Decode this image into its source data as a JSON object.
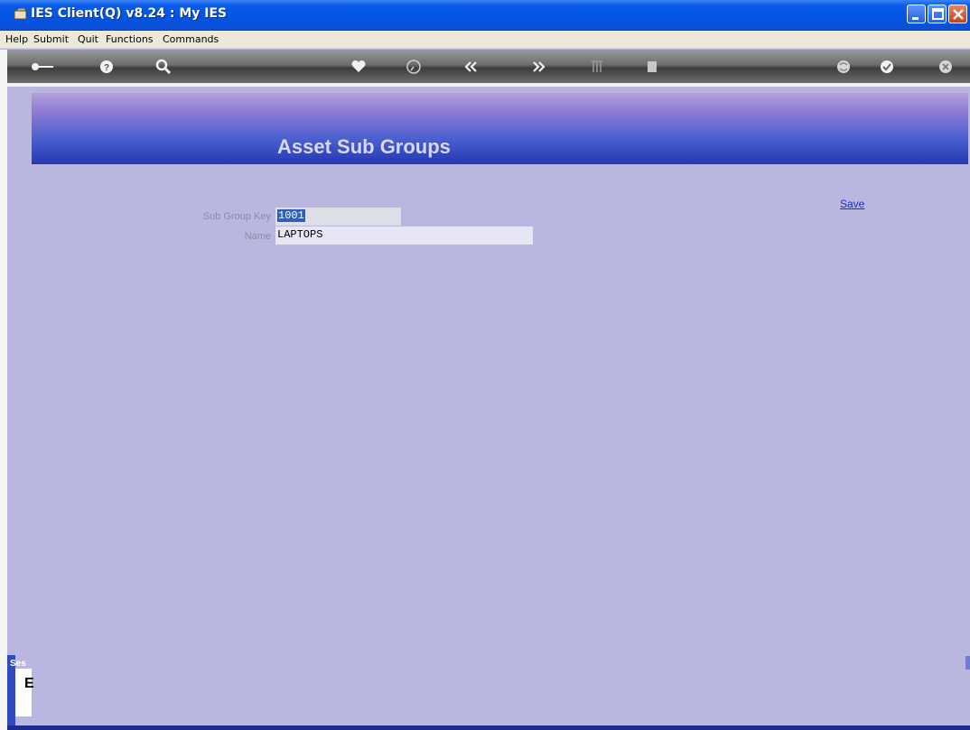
{
  "window": {
    "title": "IES Client(Q) v8.24 : My IES",
    "controls": [
      "minimize",
      "maximize",
      "close"
    ]
  },
  "menu": {
    "items": [
      "Help",
      "Submit",
      "Quit",
      "Functions",
      "Commands"
    ]
  },
  "toolbar": {
    "icons": [
      "key-icon",
      "help-icon",
      "search-icon",
      "heart-icon",
      "clock-icon",
      "previous-icon",
      "next-icon",
      "tree-icon",
      "chip-icon",
      "recycle-icon",
      "check-icon",
      "close-icon"
    ]
  },
  "page": {
    "title": "Asset Sub Groups"
  },
  "form": {
    "sub_group_key_label": "Sub Group Key",
    "sub_group_key_value": "1001",
    "name_label": "Name",
    "name_value": "LAPTOPS",
    "save_label": "Save"
  },
  "session": {
    "tab_label": "Ses",
    "glyph": "E"
  }
}
